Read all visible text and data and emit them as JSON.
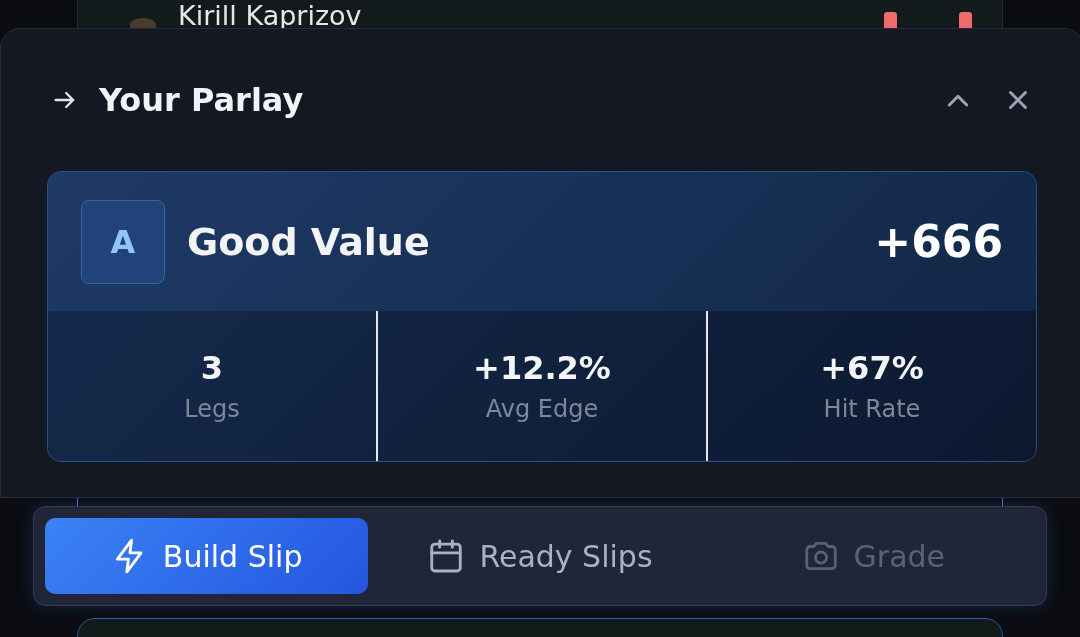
{
  "background_row": {
    "name": "Kirill Kaprizov"
  },
  "panel": {
    "title": "Your Parlay",
    "grade": "A",
    "rating": "Good Value",
    "odds": "+666",
    "stats": [
      {
        "value": "3",
        "label": "Legs"
      },
      {
        "value": "+12.2%",
        "label": "Avg Edge"
      },
      {
        "value": "+67%",
        "label": "Hit Rate"
      }
    ]
  },
  "tabs": [
    {
      "label": "Build Slip",
      "kind": "bolt",
      "selected": true,
      "disabled": false
    },
    {
      "label": "Ready Slips",
      "kind": "calendar",
      "selected": false,
      "disabled": false
    },
    {
      "label": "Grade",
      "kind": "camera",
      "selected": false,
      "disabled": true
    }
  ]
}
